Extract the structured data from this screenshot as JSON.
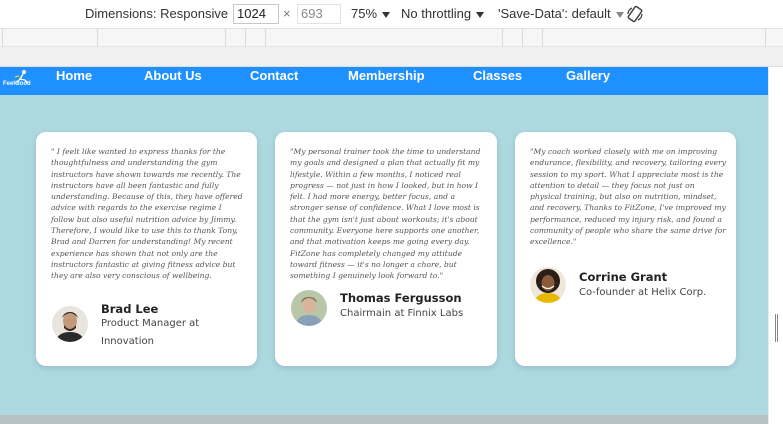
{
  "devtools": {
    "dimensions_label": "Dimensions: Responsive",
    "width_value": "1024",
    "times_sign": "×",
    "height_value": "693",
    "zoom_label": "75%",
    "throttling_label": "No throttling",
    "save_data_label": "'Save-Data': default"
  },
  "nav": {
    "logo_text": "FeelGood",
    "links": [
      "Home",
      "About Us",
      "Contact",
      "Membership",
      "Classes",
      "Gallery"
    ]
  },
  "testimonials": [
    {
      "quote": "\" I feelt like wanted to express thanks for the thoughtfulness and understanding the gym instructors have shown towards me recently. The instructors have all been fantastic and fully understanding. Because of this, they have offered advice with regards to the exercise regime I follow but also useful nutrition advice by Jimmy. Therefore, I would like to use this to thank Tony, Brad and Darren for understanding! My recent experience has shown that not only are the instructors fantastic at giving fitness advice but they are also very conscious of wellbeing.",
      "name": "Brad Lee",
      "role": "Product Manager at Innovation"
    },
    {
      "quote": "\"My personal trainer took the time to understand my goals and designed a plan that actually fit my lifestyle. Within a few months, I noticed real progress — not just in how I looked, but in how I felt. I had more energy, better focus, and a stronger sense of confidence. What I love most is that the gym isn't just about workouts; it's about community. Everyone here supports one another, and that motivation keeps me going every day. FitZone has completely changed my attitude toward fitness — it's no longer a chore, but something I genuinely look forward to.\"",
      "name": "Thomas Fergusson",
      "role": "Chairmain at Finnix Labs"
    },
    {
      "quote": "\"My coach worked closely with me on improving endurance, flexibility, and recovery, tailoring every session to my sport. What I appreciate most is the attention to detail — they focus not just on physical training, but also on nutrition, mindset, and recovery. Thanks to FitZone, I've improved my performance, reduced my injury risk, and found a community of people who share the same drive for excellence.\"",
      "name": "Corrine Grant",
      "role": "Co-founder at Helix Corp."
    }
  ],
  "colors": {
    "navbar": "#1e90ff",
    "page_background": "#add8e0",
    "card_background": "#ffffff"
  }
}
